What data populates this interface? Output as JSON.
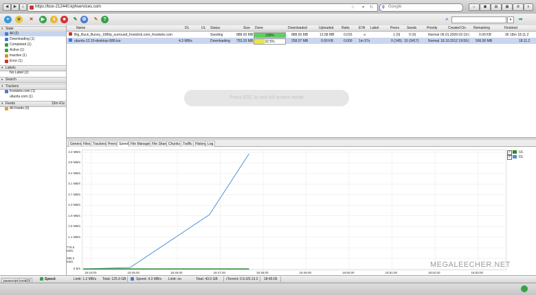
{
  "browser": {
    "url": "https://box-212440.kphservices.com",
    "search_placeholder": "Google",
    "search_icon": "google-icon"
  },
  "toolbar": {
    "icons": [
      "add-torrent-icon",
      "add-url-icon",
      "remove-icon",
      "start-icon",
      "pause-icon",
      "stop-icon",
      "rss-icon",
      "settings-icon",
      "filter-icon",
      "help-icon"
    ]
  },
  "sidebar": {
    "state_header": "State",
    "state_items": [
      {
        "label": "All (2)",
        "color": "#4a7bd0"
      },
      {
        "label": "Downloading (1)",
        "color": "#3a7be0"
      },
      {
        "label": "Completed (1)",
        "color": "#3a9a3a"
      },
      {
        "label": "Active (1)",
        "color": "#3aa04a"
      },
      {
        "label": "Inactive (1)",
        "color": "#d8942a"
      },
      {
        "label": "Error (1)",
        "color": "#d03030"
      }
    ],
    "labels_header": "Labels",
    "labels_items": [
      "No Label (2)"
    ],
    "search_header": "Search",
    "trackers_header": "Trackers",
    "trackers_items": [
      "frostwire.com (1)",
      "ubuntu.com (1)"
    ],
    "feeds_header": "Feeds",
    "feeds_time": "15m 41s",
    "feeds_items": [
      "All Feeds (0)"
    ]
  },
  "list": {
    "columns": [
      "Name",
      "DL",
      "UL",
      "Status",
      "Size",
      "Done",
      "Downloaded",
      "Uploaded",
      "Ratio",
      "ETA",
      "Label",
      "Peers",
      "Seeds",
      "Priority",
      "Created On",
      "Remaining",
      "Finished"
    ],
    "rows": [
      {
        "name": "Big_Buck_Bunny_1080p_surround_frostclick.com_frostwire.com",
        "dl": "",
        "ul": "",
        "status": "Seeding",
        "size": "888.93 MB",
        "done": "100%",
        "done_frac": 1.0,
        "done_color": "#5fcf5f",
        "downloaded": "888.93 MB",
        "uploaded": "13.58 MB",
        "ratio": "0.015",
        "eta": "∞",
        "label": "",
        "peers": "1 (0)",
        "seeds": "0 (0)",
        "priority": "Normal",
        "created": "06.01.2009 02:19:(",
        "remaining": "0.00 KB",
        "finished": "3h 18m 18.11.2",
        "icon": "red"
      },
      {
        "name": "ubuntu-12.10-desktop-i386.iso",
        "dl": "4.3 MB/s",
        "ul": "",
        "status": "Downloading",
        "size": "753.20 MB",
        "done": "32.5%",
        "done_frac": 0.325,
        "done_color": "#e8e840",
        "downloaded": "258.07 MB",
        "uploaded": "0.00 KB",
        "ratio": "0.000",
        "eta": "1m 57s",
        "label": "",
        "peers": "0 (145)",
        "seeds": "15 (3417)",
        "priority": "Normal",
        "created": "18.10.2012 19:59:(",
        "remaining": "506.00 MB",
        "finished": "18.11.2",
        "icon": "blue"
      }
    ],
    "overlay_text": "Press ESC to exit full screen mode"
  },
  "tabs": [
    "General",
    "Files",
    "Trackers",
    "Peers",
    "Speed",
    "File Manager",
    "File Share",
    "Chunks",
    "Traffic",
    "History",
    "Log"
  ],
  "active_tab": "Speed",
  "chart_data": {
    "type": "line",
    "y_ticks": [
      "4.2 MB/s",
      "3.8 MB/s",
      "3.4 MB/s",
      "3.1 MB/s",
      "2.7 MB/s",
      "2.3 MB/s",
      "1.9 MB/s",
      "1.5 MB/s",
      "1.1 MB/s",
      "779.5 KB/s",
      "396.2 KB/s",
      "0 B/s"
    ],
    "x_ticks": [
      "18:44:00",
      "18:45:00",
      "18:46:00",
      "18:47:00",
      "18:48:00",
      "18:49:00",
      "18:50:00",
      "18:51:00",
      "18:52:00",
      "18:53:00"
    ],
    "series": [
      {
        "name": "DL",
        "color": "#4a90d9",
        "x": [
          0,
          1.3,
          3.5,
          4.6
        ],
        "y": [
          0,
          0.05,
          2.0,
          4.25
        ]
      },
      {
        "name": "UL",
        "color": "#2a8a2a",
        "x": [
          0,
          4.6
        ],
        "y": [
          0,
          0
        ]
      }
    ],
    "legend": [
      "UL",
      "DL"
    ],
    "legend_colors": [
      "#2a8a2a",
      "#4a90d9"
    ],
    "ylim": [
      0,
      4.3
    ]
  },
  "status": {
    "tooltip": "javascript:(void(0)",
    "speed_lbl": "Speed:",
    "dl_limit": "Limit: 1.2 MB/s",
    "dl_total": "Total: 125.9 GB",
    "ul_speed": "Speed: 4.3 MB/s",
    "ul_limit": "Limit: no",
    "ul_total": "Total: 43.0 GB",
    "rtorrent": "rTorrent: 0.9.2/0.13.2",
    "time": "18:45:05"
  },
  "watermark": "MEGALEECHER.NET"
}
